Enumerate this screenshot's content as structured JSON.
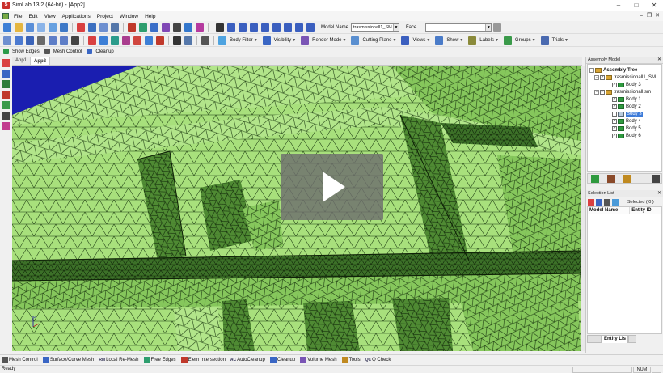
{
  "window": {
    "title": "SimLab 13.2 (64-bit) - [App2]",
    "logo_text": "S"
  },
  "menu": [
    "File",
    "Edit",
    "View",
    "Applications",
    "Project",
    "Window",
    "Help"
  ],
  "toolbar1": {
    "model_name_label": "Model Name",
    "model_name_value": "trasmissionall1_SM",
    "face_label": "Face",
    "face_value": ""
  },
  "toolbar2": {
    "body_filter": "Body Filter",
    "visibility": "Visibility",
    "render_mode": "Render Mode",
    "cutting_plane": "Cutting Plane",
    "views": "Views",
    "show": "Show",
    "labels": "Labels",
    "groups": "Groups",
    "trials": "Trials"
  },
  "toolbar3": {
    "show_edges": "Show Edges",
    "mesh_control": "Mesh Control",
    "cleanup": "Cleanup"
  },
  "doc_tabs": [
    "App1",
    "App2"
  ],
  "assembly": {
    "panel_title": "Assembly Model",
    "root": "Assembly Tree",
    "nodes": [
      {
        "label": "trasmissionall1_SM",
        "level": 1,
        "checked": true
      },
      {
        "label": "Body 3",
        "level": 2,
        "checked": true
      },
      {
        "label": "trasmissionall.sm",
        "level": 1,
        "checked": true
      },
      {
        "label": "Body 1",
        "level": 2,
        "checked": true
      },
      {
        "label": "Body 2",
        "level": 2,
        "checked": true
      },
      {
        "label": "Body 3",
        "level": 2,
        "checked": false
      },
      {
        "label": "Body 4",
        "level": 2,
        "checked": true
      },
      {
        "label": "Body 5",
        "level": 2,
        "checked": true
      },
      {
        "label": "Body 6",
        "level": 2,
        "checked": true
      }
    ]
  },
  "selection": {
    "panel_title": "Selection List",
    "selected_text": "Selected ( 0 )",
    "columns": [
      "Model Name",
      "Entity ID"
    ]
  },
  "bottom_tab": "Entity Lis",
  "bottom_toolbar": [
    {
      "label": "Mesh Control",
      "icon": "mesh-control-icon"
    },
    {
      "label": "Surface/Curve Mesh",
      "icon": "surface-mesh-icon"
    },
    {
      "label": "Local Re-Mesh",
      "icon": "remesh-icon",
      "prefix": "RM"
    },
    {
      "label": "Free Edges",
      "icon": "free-edges-icon"
    },
    {
      "label": "Elem Intersection",
      "icon": "elem-intersection-icon"
    },
    {
      "label": "AutoCleanup",
      "icon": "autocleanup-icon",
      "prefix": "AC"
    },
    {
      "label": "Cleanup",
      "icon": "cleanup-icon"
    },
    {
      "label": "Volume Mesh",
      "icon": "volume-mesh-icon"
    },
    {
      "label": "Tools",
      "icon": "tools-icon"
    },
    {
      "label": "Q Check",
      "icon": "qcheck-icon",
      "prefix": "QC"
    }
  ],
  "status": {
    "text": "Ready",
    "num": "NUM"
  },
  "colors": {
    "mesh_light": "#a7e07a",
    "mesh_dark": "#5b9a3c",
    "edge": "#17300e",
    "background": "#1a1eb0",
    "selected": "#3d7bd9"
  }
}
